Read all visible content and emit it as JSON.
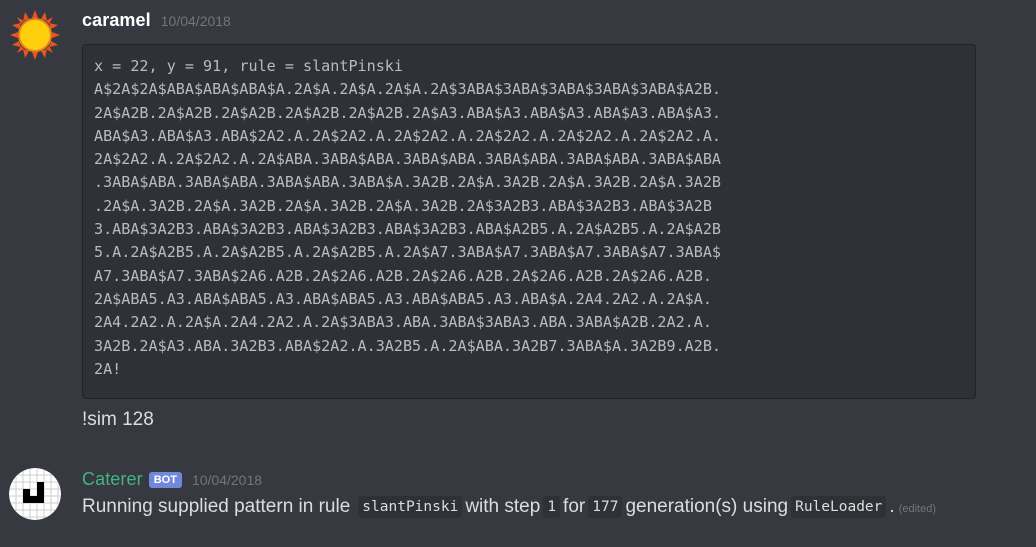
{
  "messages": {
    "first": {
      "username": "caramel",
      "timestamp": "10/04/2018",
      "code_lines": [
        "x = 22, y = 91, rule = slantPinski",
        "A$2A$2A$ABA$ABA$ABA$A.2A$A.2A$A.2A$A.2A$3ABA$3ABA$3ABA$3ABA$3ABA$A2B.",
        "2A$A2B.2A$A2B.2A$A2B.2A$A2B.2A$A2B.2A$A3.ABA$A3.ABA$A3.ABA$A3.ABA$A3.",
        "ABA$A3.ABA$A3.ABA$2A2.A.2A$2A2.A.2A$2A2.A.2A$2A2.A.2A$2A2.A.2A$2A2.A.",
        "2A$2A2.A.2A$2A2.A.2A$ABA.3ABA$ABA.3ABA$ABA.3ABA$ABA.3ABA$ABA.3ABA$ABA",
        ".3ABA$ABA.3ABA$ABA.3ABA$ABA.3ABA$A.3A2B.2A$A.3A2B.2A$A.3A2B.2A$A.3A2B",
        ".2A$A.3A2B.2A$A.3A2B.2A$A.3A2B.2A$A.3A2B.2A$3A2B3.ABA$3A2B3.ABA$3A2B",
        "3.ABA$3A2B3.ABA$3A2B3.ABA$3A2B3.ABA$3A2B3.ABA$A2B5.A.2A$A2B5.A.2A$A2B",
        "5.A.2A$A2B5.A.2A$A2B5.A.2A$A2B5.A.2A$A7.3ABA$A7.3ABA$A7.3ABA$A7.3ABA$",
        "A7.3ABA$A7.3ABA$2A6.A2B.2A$2A6.A2B.2A$2A6.A2B.2A$2A6.A2B.2A$2A6.A2B.",
        "2A$ABA5.A3.ABA$ABA5.A3.ABA$ABA5.A3.ABA$ABA5.A3.ABA$A.2A4.2A2.A.2A$A.",
        "2A4.2A2.A.2A$A.2A4.2A2.A.2A$3ABA3.ABA.3ABA$3ABA3.ABA.3ABA$A2B.2A2.A.",
        "3A2B.2A$A3.ABA.3A2B3.ABA$2A2.A.3A2B5.A.2A$ABA.3A2B7.3ABA$A.3A2B9.A2B.",
        "2A!"
      ],
      "follow_text": "!sim 128"
    },
    "second": {
      "username": "Caterer",
      "bot_tag": "BOT",
      "timestamp": "10/04/2018",
      "text_1": "Running supplied pattern in rule",
      "code_rule": "slantPinski",
      "text_2": "with step",
      "code_step": "1",
      "text_3": "for",
      "code_gens": "177",
      "text_4": "generation(s) using",
      "code_loader": "RuleLoader",
      "text_5": ".",
      "edited": "(edited)"
    }
  },
  "colors": {
    "background": "#36393f",
    "code_background": "#2f3136",
    "bot_name": "#43b581",
    "bot_tag": "#7289da",
    "timestamp": "#72767d"
  },
  "icons": {
    "caramel_avatar": "sun-avatar-icon",
    "caterer_avatar": "pixel-glider-avatar-icon"
  }
}
